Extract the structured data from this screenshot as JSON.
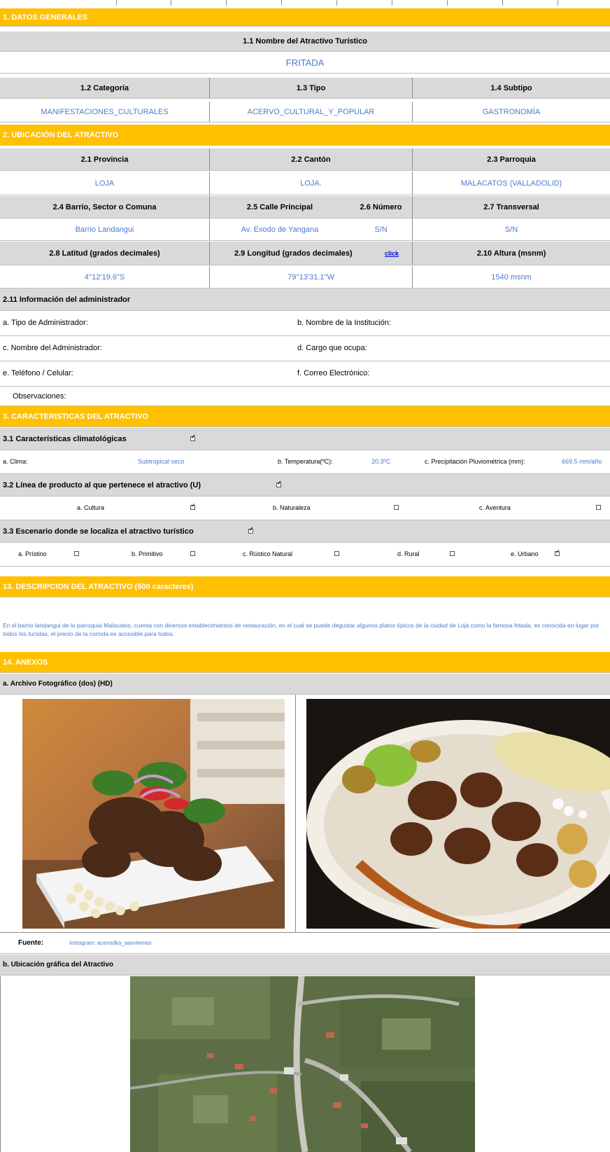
{
  "s1": {
    "title": "1. DATOS GENERALES",
    "name_label": "1.1 Nombre del Atractivo Turístico",
    "name_value": "FRITADA",
    "cat_label": "1.2 Categoría",
    "tipo_label": "1.3 Tipo",
    "subtipo_label": "1.4 Subtipo",
    "cat_value": "MANIFESTACIONES_CULTURALES",
    "tipo_value": "ACERVO_CULTURAL_Y_POPULAR",
    "subtipo_value": "GASTRONOMÍA"
  },
  "s2": {
    "title": "2. UBICACIÓN DEL ATRACTIVO",
    "provincia_label": "2.1 Provincia",
    "canton_label": "2.2 Cantón",
    "parroquia_label": "2.3 Parroquia",
    "provincia_value": "LOJA",
    "canton_value": "LOJA.",
    "parroquia_value": "MALACATOS (VALLADOLID)",
    "barrio_label": "2.4 Barrio, Sector o Comuna",
    "calle_label": "2.5 Calle Principal",
    "numero_label": "2.6 Número",
    "transversal_label": "2.7 Transversal",
    "barrio_value": "Barrio Landangui",
    "calle_value": "Av. Exodo de Yangana",
    "numero_value": "S/N",
    "transversal_value": "S/N",
    "latitud_label": "2.8 Latitud (grados decimales)",
    "longitud_label": "2.9 Longitud (grados decimales)",
    "click_link": "click",
    "altura_label": "2.10 Altura (msnm)",
    "latitud_value": "4°12'19.6\"S",
    "longitud_value": "79°13'31.1\"W",
    "altura_value": "1540 msnm",
    "admin_title": "2.11 Información del administrador",
    "tipo_admin": "a. Tipo de Administrador:",
    "nombre_inst": "b. Nombre de la Institución:",
    "nombre_admin": "c. Nombre del Administrador:",
    "cargo": "d. Cargo que ocupa:",
    "telefono": "e. Teléfono / Celular:",
    "correo": "f. Correo Electrónico:",
    "observaciones": "Observaciones:"
  },
  "s3": {
    "title": "3. CARACTERISTICAS DEL ATRACTIVO",
    "clima_title": "3.1 Características climatológicas",
    "clima_label": "a. Clima:",
    "clima_value": "Subtropical seco",
    "temp_label": "b. Temperatura(ºC):",
    "temp_value": "20.3ºC",
    "precip_label": "c. Precipitación Pluviométrica (mm):",
    "precip_value": "669.5 mm/año",
    "linea_title": "3.2 Línea de producto al que pertenece el atractivo (U)",
    "cultura": "a. Cultura",
    "naturaleza": "b. Naturaleza",
    "aventura": "c. Aventura",
    "escenario_title": "3.3 Escenario donde se localiza el atractivo turístico",
    "pristino": "a. Prístino",
    "primitivo": "b. Primitivo",
    "rustico": "c. Rústico Natural",
    "rural": "d. Rural",
    "urbano": "e. Urbano"
  },
  "s13": {
    "title": "13. DESCRIPCION DEL ATRACTIVO (500 caracteres)",
    "text": "En el barrio landangui de la parroquia Malacatos, cuenta con diversos establecimientos de restauración, en el cual se puede degustar algunos platos típicos de la ciudad de Loja como la famosa fritada, es conocida en lugar por todos los turistas, el precio de la comida es accesible para todos."
  },
  "s14": {
    "title": "14. ANEXOS",
    "foto_title": "a. Archivo Fotográfico (dos) (HD)",
    "fuente_label": "Fuente:",
    "fuente_value": "Instagram: acevodka_sanviernes",
    "ubicacion_title": "b. Ubicación gráfica del Atractivo"
  },
  "colors": {
    "section": "#ffc000",
    "header": "#d9d9d9",
    "value_text": "#4a7bd0"
  }
}
